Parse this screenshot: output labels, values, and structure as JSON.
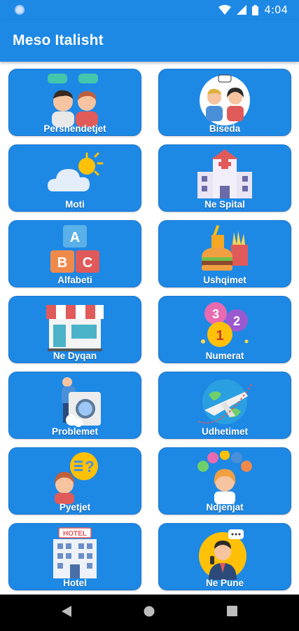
{
  "status_bar": {
    "time": "4:04"
  },
  "app_bar": {
    "title": "Meso Italisht"
  },
  "categories": [
    {
      "label": "Pershendetjet",
      "icon": "greeting-people-icon"
    },
    {
      "label": "Biseda",
      "icon": "conversation-icon"
    },
    {
      "label": "Moti",
      "icon": "weather-icon"
    },
    {
      "label": "Ne Spital",
      "icon": "hospital-icon"
    },
    {
      "label": "Alfabeti",
      "icon": "abc-blocks-icon"
    },
    {
      "label": "Ushqimet",
      "icon": "food-icon"
    },
    {
      "label": "Ne Dyqan",
      "icon": "shop-icon"
    },
    {
      "label": "Numerat",
      "icon": "numbers-balloons-icon"
    },
    {
      "label": "Problemet",
      "icon": "washing-problem-icon"
    },
    {
      "label": "Udhetimet",
      "icon": "travel-plane-icon"
    },
    {
      "label": "Pyetjet",
      "icon": "question-icon"
    },
    {
      "label": "Ndjenjat",
      "icon": "feelings-icon"
    },
    {
      "label": "Hotel",
      "icon": "hotel-building-icon"
    },
    {
      "label": "Ne Pune",
      "icon": "business-work-icon"
    }
  ],
  "hotel_sign": "HOTEL",
  "abc_letters": [
    "A",
    "B",
    "C"
  ],
  "number_balloons": [
    "3",
    "2",
    "1"
  ]
}
